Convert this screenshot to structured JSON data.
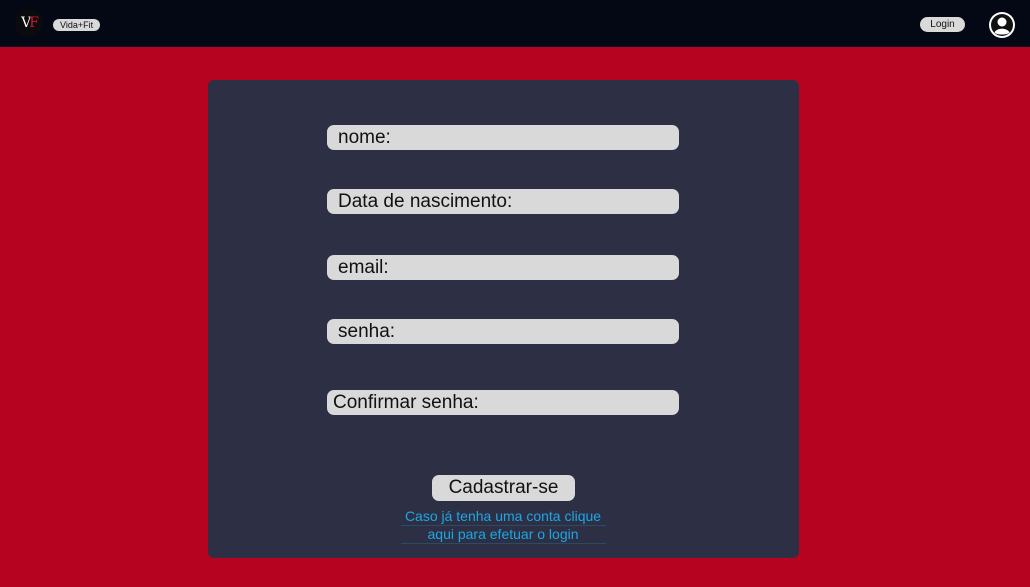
{
  "header": {
    "logo_letters": [
      "V",
      "F"
    ],
    "brand_label": "Vida+Fit",
    "login_label": "Login",
    "avatar_icon": "user-avatar-icon"
  },
  "form": {
    "fields": [
      {
        "label": "nome:"
      },
      {
        "label": "Data de nascimento:"
      },
      {
        "label": "email:"
      },
      {
        "label": "senha:"
      },
      {
        "label": "Confirmar senha:"
      }
    ],
    "submit_label": "Cadastrar-se",
    "login_link_line1": "Caso já tenha uma conta clique",
    "login_link_line2": "aqui para efetuar o login"
  },
  "colors": {
    "background": "#b6031f",
    "topbar": "#030814",
    "card": "#2d3045",
    "field": "#d9d9d9",
    "link": "#1ea6e4"
  }
}
